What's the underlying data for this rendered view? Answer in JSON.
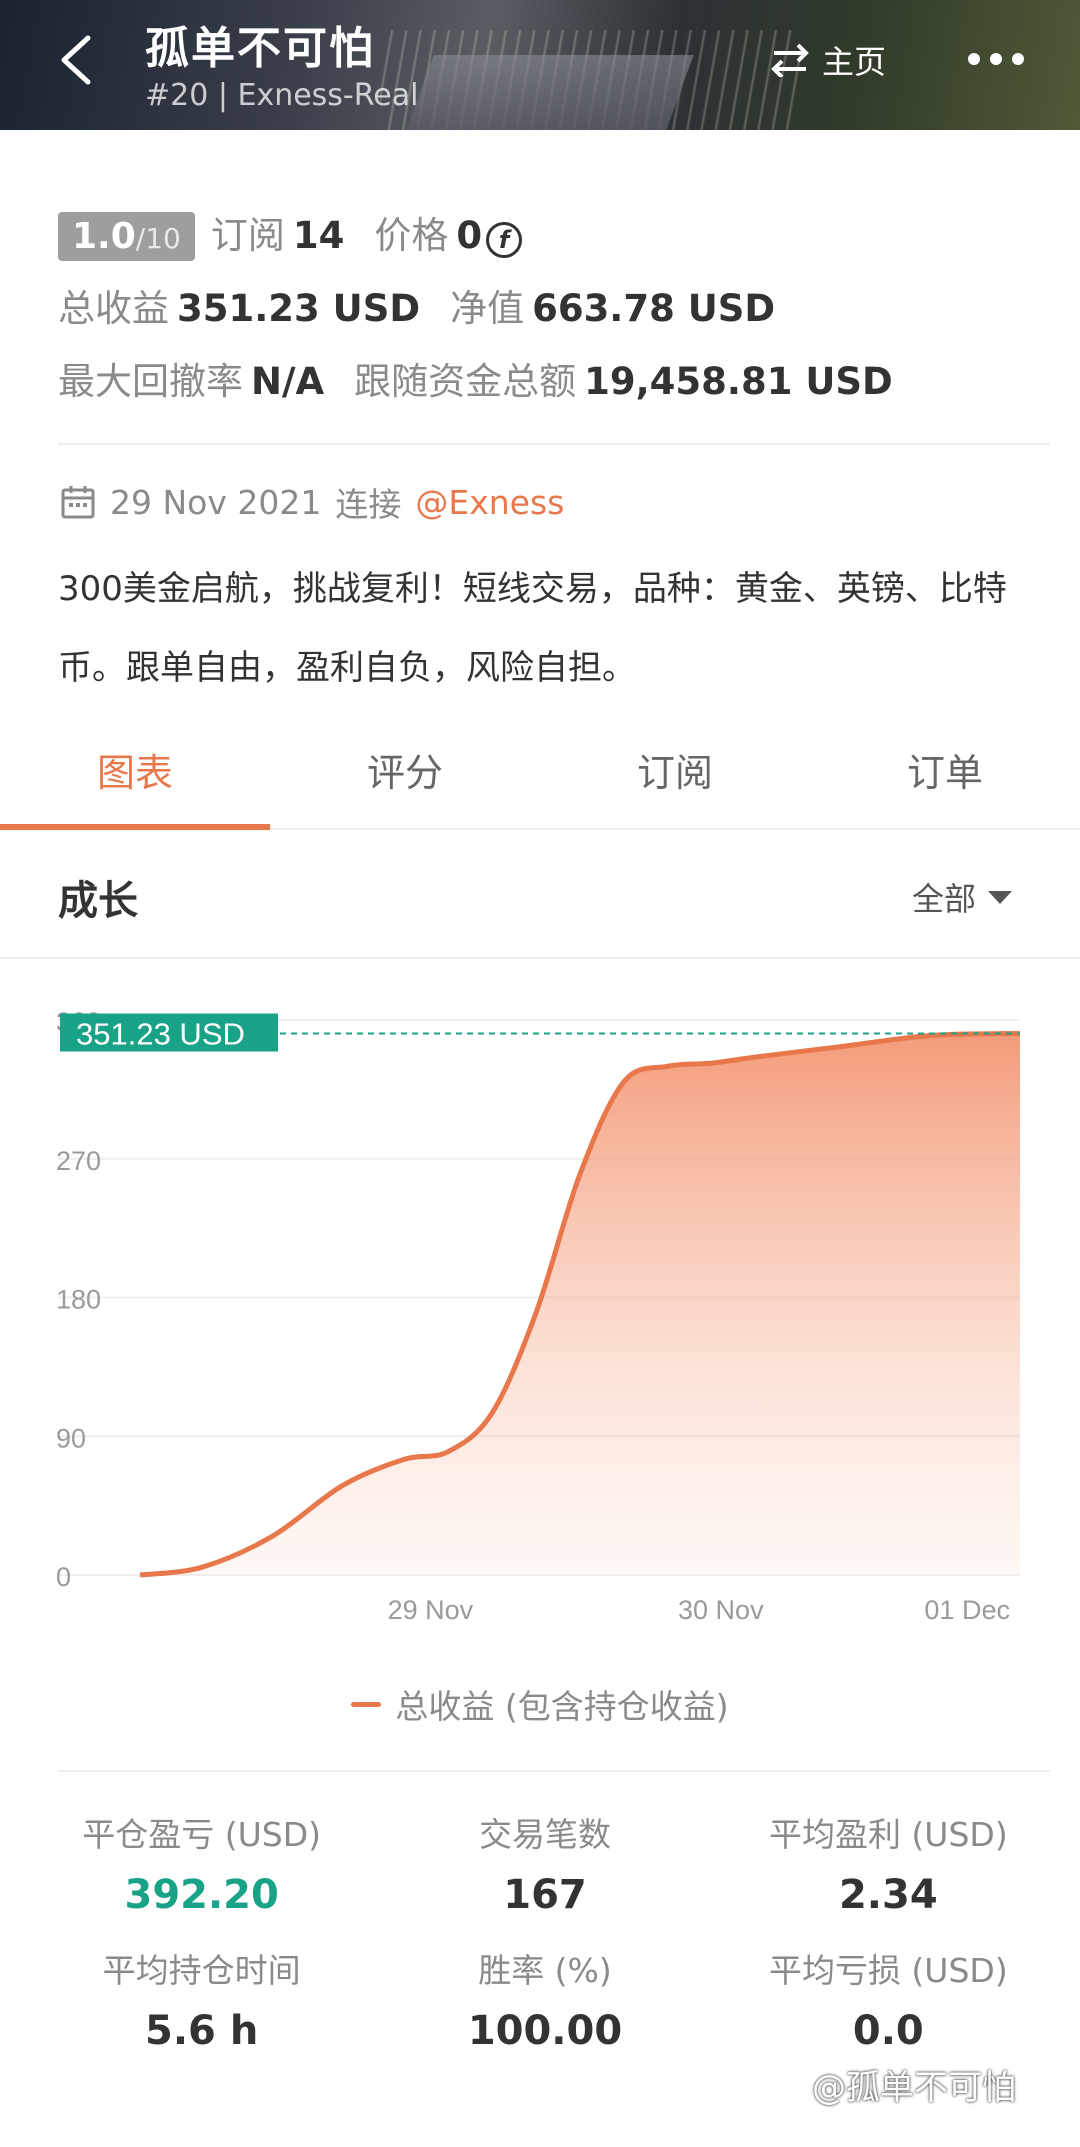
{
  "header": {
    "title": "孤单不可怕",
    "subtitle": "#20 | Exness-Real",
    "home_label": "主页"
  },
  "stats": {
    "rating": "1.0",
    "rating_max": "/10",
    "subscribe_label": "订阅",
    "subscribe_count": "14",
    "price_label": "价格",
    "price_value": "0",
    "total_profit_label": "总收益",
    "total_profit_value": "351.23 USD",
    "equity_label": "净值",
    "equity_value": "663.78 USD",
    "max_drawdown_label": "最大回撤率",
    "max_drawdown_value": "N/A",
    "follow_funds_label": "跟随资金总额",
    "follow_funds_value": "19,458.81 USD"
  },
  "joined": {
    "date": "29 Nov 2021",
    "connect_label": "连接",
    "broker": "@Exness"
  },
  "description": "300美金启航，挑战复利！短线交易，品种：黄金、英镑、比特币。跟单自由，盈利自负，风险自担。",
  "tabs": [
    {
      "label": "图表",
      "active": true
    },
    {
      "label": "评分",
      "active": false
    },
    {
      "label": "订阅",
      "active": false
    },
    {
      "label": "订单",
      "active": false
    }
  ],
  "section": {
    "title": "成长",
    "filter": "全部"
  },
  "chart_data": {
    "type": "area",
    "current_label": "351.23 USD",
    "y_ticks": [
      "0",
      "90",
      "180",
      "270",
      "360"
    ],
    "ylim": [
      0,
      360
    ],
    "x_ticks": [
      "29 Nov",
      "30 Nov",
      "01 Dec"
    ],
    "series": [
      {
        "name": "总收益 (包含持仓收益)",
        "color": "#e8784b",
        "x": [
          0,
          0.07,
          0.15,
          0.23,
          0.3,
          0.35,
          0.4,
          0.45,
          0.5,
          0.55,
          0.6,
          0.65,
          0.7,
          0.8,
          0.9,
          1.0
        ],
        "values": [
          0,
          5,
          25,
          58,
          75,
          80,
          105,
          170,
          260,
          320,
          330,
          332,
          336,
          343,
          350,
          351.23
        ]
      }
    ]
  },
  "legend": "总收益 (包含持仓收益)",
  "metrics": [
    {
      "label": "平仓盈亏 (USD)",
      "value": "392.20",
      "color": "green"
    },
    {
      "label": "交易笔数",
      "value": "167",
      "color": "normal"
    },
    {
      "label": "平均盈利 (USD)",
      "value": "2.34",
      "color": "normal"
    },
    {
      "label": "平均持仓时间",
      "value": "5.6 h",
      "color": "normal"
    },
    {
      "label": "胜率 (%)",
      "value": "100.00",
      "color": "normal"
    },
    {
      "label": "平均亏损 (USD)",
      "value": "0.0",
      "color": "normal"
    }
  ],
  "watermark": "@孤单不可怕"
}
